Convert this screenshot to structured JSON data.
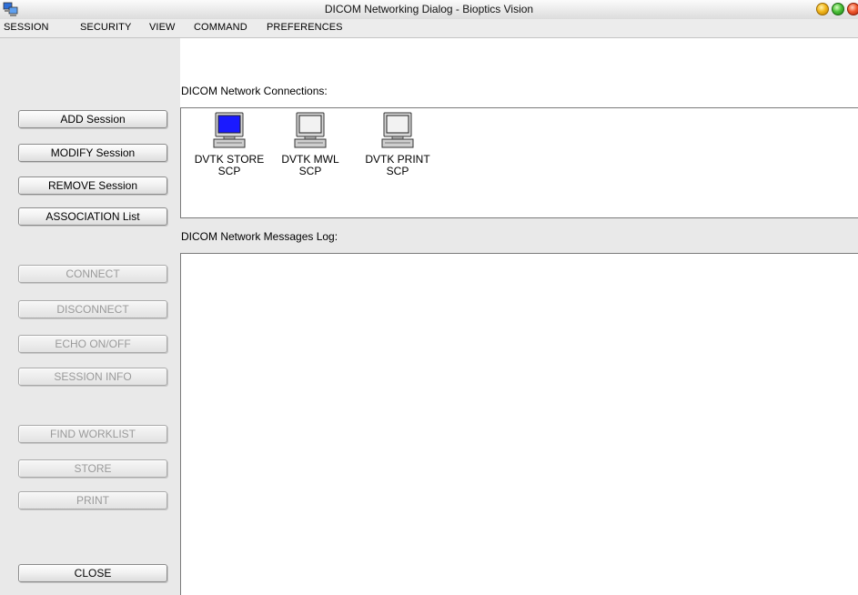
{
  "window": {
    "title": "DICOM Networking Dialog - Bioptics Vision",
    "app_icon": "network-computers-icon"
  },
  "menu": [
    "SESSION",
    "SECURITY",
    "VIEW",
    "COMMAND",
    "PREFERENCES"
  ],
  "session_buttons": {
    "add": "ADD Session",
    "modify": "MODIFY Session",
    "remove": "REMOVE Session",
    "association": "ASSOCIATION List"
  },
  "action_buttons": {
    "connect": "CONNECT",
    "disconnect": "DISCONNECT",
    "echo": "ECHO ON/OFF",
    "session_info": "SESSION INFO",
    "find_worklist": "FIND WORKLIST",
    "store": "STORE",
    "print": "PRINT",
    "close": "CLOSE"
  },
  "connections": {
    "label": "DICOM Network Connections:",
    "items": [
      {
        "line1": "DVTK STORE",
        "line2": "SCP",
        "icon": "computer-icon",
        "selected": true
      },
      {
        "line1": "DVTK MWL",
        "line2": "SCP",
        "icon": "computer-icon",
        "selected": false
      },
      {
        "line1": "DVTK PRINT",
        "line2": "SCP",
        "icon": "computer-icon",
        "selected": false
      }
    ]
  },
  "log": {
    "label": "DICOM Network Messages Log:"
  },
  "colors": {
    "selected_screen": "#1a1aff",
    "idle_screen": "#f2f2f2",
    "disabled_text": "#9a9a9a"
  }
}
